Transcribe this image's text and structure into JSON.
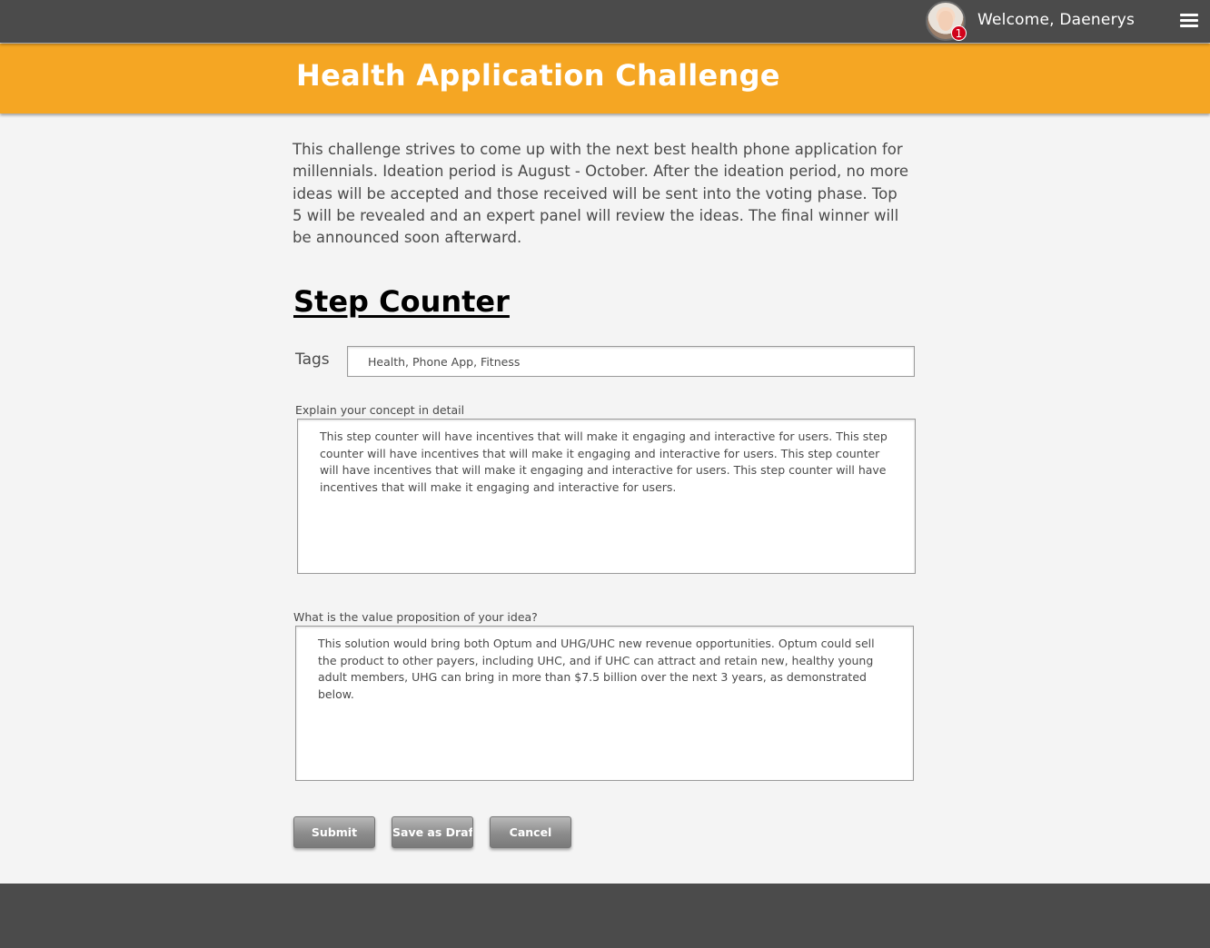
{
  "header": {
    "welcome_text": "Welcome, Daenerys",
    "notification_count": "1",
    "avatar_icon": "user-avatar",
    "menu_icon": "hamburger-menu-icon"
  },
  "banner": {
    "title": "Health Application Challenge",
    "color": "#f5a623"
  },
  "challenge": {
    "description": "This challenge strives to come up with the next best health phone application for millennials. Ideation period is August - October. After the ideation period, no more ideas will be accepted and those received will be sent into the voting phase. Top 5 will be revealed and an expert panel will review the ideas. The final winner will be announced soon afterward."
  },
  "idea": {
    "title": "Step Counter",
    "tags_label": "Tags",
    "tags_value": "Health, Phone App, Fitness",
    "concept_label": "Explain your concept in detail",
    "concept_value": "This step counter will have incentives that will make it engaging and interactive for users. This step counter will have incentives that will make it engaging and interactive for users. This step counter will have incentives that will make it engaging and interactive for users. This step counter will have incentives that will make it engaging and interactive for users.",
    "value_label": "What is the value proposition of your idea?",
    "value_value": "This solution would bring both Optum and UHG/UHC new revenue opportunities. Optum could sell the product to other payers, including UHC, and if UHC can attract and retain new, healthy young adult members, UHG can bring in more than $7.5 billion over the next 3 years, as demonstrated below."
  },
  "actions": {
    "submit": "Submit",
    "save_draft": "Save as Draft",
    "cancel": "Cancel"
  },
  "colors": {
    "topbar": "#4b4b4b",
    "background": "#f4f4f4",
    "badge": "#d0021b"
  }
}
